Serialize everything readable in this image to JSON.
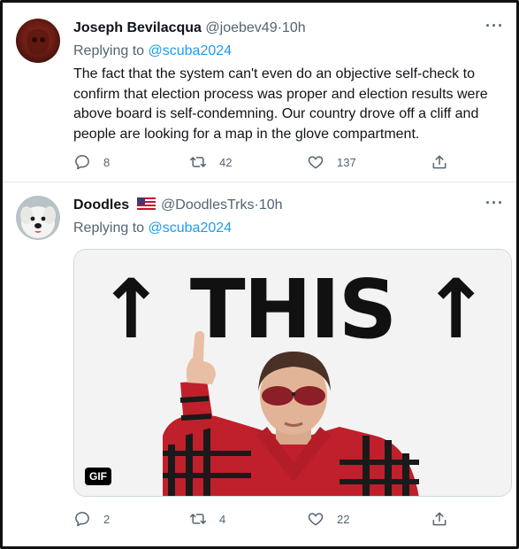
{
  "tweets": [
    {
      "author_name": "Joseph Bevilacqua",
      "author_handle": "@joebev49",
      "separator": "·",
      "time": "10h",
      "replying_label": "Replying to",
      "replying_to": "@scuba2024",
      "text": "The fact that the system can't even do an objective self-check to confirm that election process was proper and election results were above board is self-condemning. Our country drove off a cliff and people are looking for a map in the glove compartment.",
      "reply_count": "8",
      "retweet_count": "42",
      "like_count": "137",
      "more_label": "···"
    },
    {
      "author_name": "Doodles",
      "author_handle": "@DoodlesTrks",
      "separator": "·",
      "time": "10h",
      "replying_label": "Replying to",
      "replying_to": "@scuba2024",
      "gif_caption": "↑ THIS ↑",
      "gif_badge": "GIF",
      "reply_count": "2",
      "retweet_count": "4",
      "like_count": "22",
      "more_label": "···"
    }
  ],
  "icons": {
    "reply": "reply-icon",
    "retweet": "retweet-icon",
    "like": "heart-icon",
    "share": "share-icon",
    "more": "more-icon",
    "flag": "us-flag-icon"
  },
  "colors": {
    "link": "#1d9bf0",
    "secondary_text": "#536471",
    "primary_text": "#0f1419"
  }
}
